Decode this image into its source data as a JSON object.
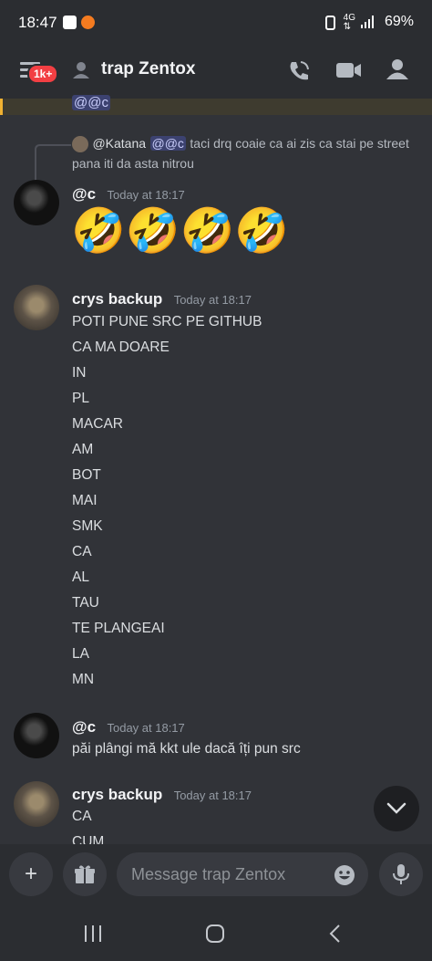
{
  "status_bar": {
    "time": "18:47",
    "battery": "69%"
  },
  "header": {
    "title": "trap Zentox",
    "badge": "1k+"
  },
  "top_mention": "@@c",
  "reply": {
    "author": "@Katana",
    "mention": "@@c",
    "text_line1": "taci drq coaie ca ai zis ca stai pe street",
    "text_line2": "pana iti da asta nitrou"
  },
  "messages": [
    {
      "author": "@c",
      "time": "Today at 18:17",
      "emoji": "🤣🤣🤣🤣"
    },
    {
      "author": "crys backup",
      "time": "Today at 18:17",
      "lines": [
        "POTI PUNE SRC PE GITHUB",
        "CA MA DOARE",
        "IN",
        "PL",
        "MACAR",
        "AM",
        "BOT",
        "MAI",
        "SMK",
        "CA",
        "AL",
        "TAU",
        "TE PLANGEAI",
        "LA",
        "MN"
      ]
    },
    {
      "author": "@c",
      "time": "Today at 18:17",
      "text": "păi plângi mă kkt ule dacă îți pun src"
    },
    {
      "author": "crys backup",
      "time": "Today at 18:17",
      "lines": [
        "CA",
        "CUM"
      ]
    }
  ],
  "composer": {
    "placeholder": "Message trap Zentox"
  },
  "icons": {
    "menu": "hamburger-icon",
    "members": "person-icon",
    "call": "phone-icon",
    "video": "video-icon",
    "people": "people-icon",
    "plus": "plus-icon",
    "gift": "gift-icon",
    "emoji": "smile-icon",
    "mic": "mic-icon"
  }
}
